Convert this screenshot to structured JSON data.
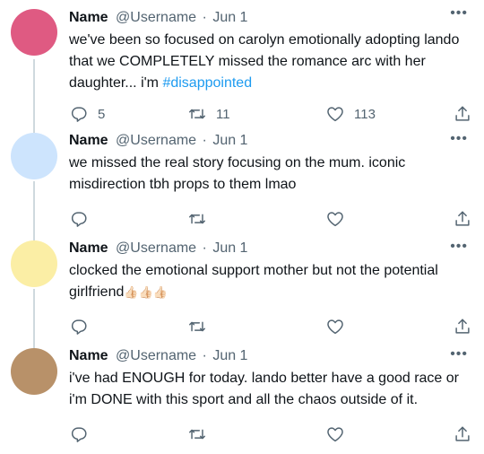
{
  "colors": {
    "text": "#0f1419",
    "secondary": "#536471",
    "link": "#1d9bf0",
    "thread_line": "#cfd9de"
  },
  "icons": {
    "reply": "reply-icon",
    "retweet": "retweet-icon",
    "like": "heart-icon",
    "share": "share-icon",
    "more": "more-icon"
  },
  "more_label": "•••",
  "tweets": [
    {
      "avatar_color": "#df5a82",
      "name": "Name",
      "username": "@Username",
      "dot": "·",
      "date": "Jun 1",
      "text": "we've been so focused on carolyn emotionally adopting lando that we COMPLETELY missed the romance arc with her daughter... i'm ",
      "hashtag": "#disappointed",
      "replies": "5",
      "retweets": "11",
      "likes": "113"
    },
    {
      "avatar_color": "#cde4fd",
      "name": "Name",
      "username": "@Username",
      "dot": "·",
      "date": "Jun 1",
      "text": "we missed the real story focusing on the mum. iconic misdirection tbh props to them lmao",
      "replies": "",
      "retweets": "",
      "likes": ""
    },
    {
      "avatar_color": "#fbeea5",
      "name": "Name",
      "username": "@Username",
      "dot": "·",
      "date": "Jun 1",
      "text": "clocked the emotional support mother but not the potential girlfriend",
      "emoji": "👍🏻👍🏻👍🏻",
      "replies": "",
      "retweets": "",
      "likes": ""
    },
    {
      "avatar_color": "#b89169",
      "name": "Name",
      "username": "@Username",
      "dot": "·",
      "date": "Jun 1",
      "text": "i've had ENOUGH for today. lando better have a good race or i'm DONE with this sport and all the chaos outside of it.",
      "replies": "",
      "retweets": "",
      "likes": ""
    }
  ]
}
